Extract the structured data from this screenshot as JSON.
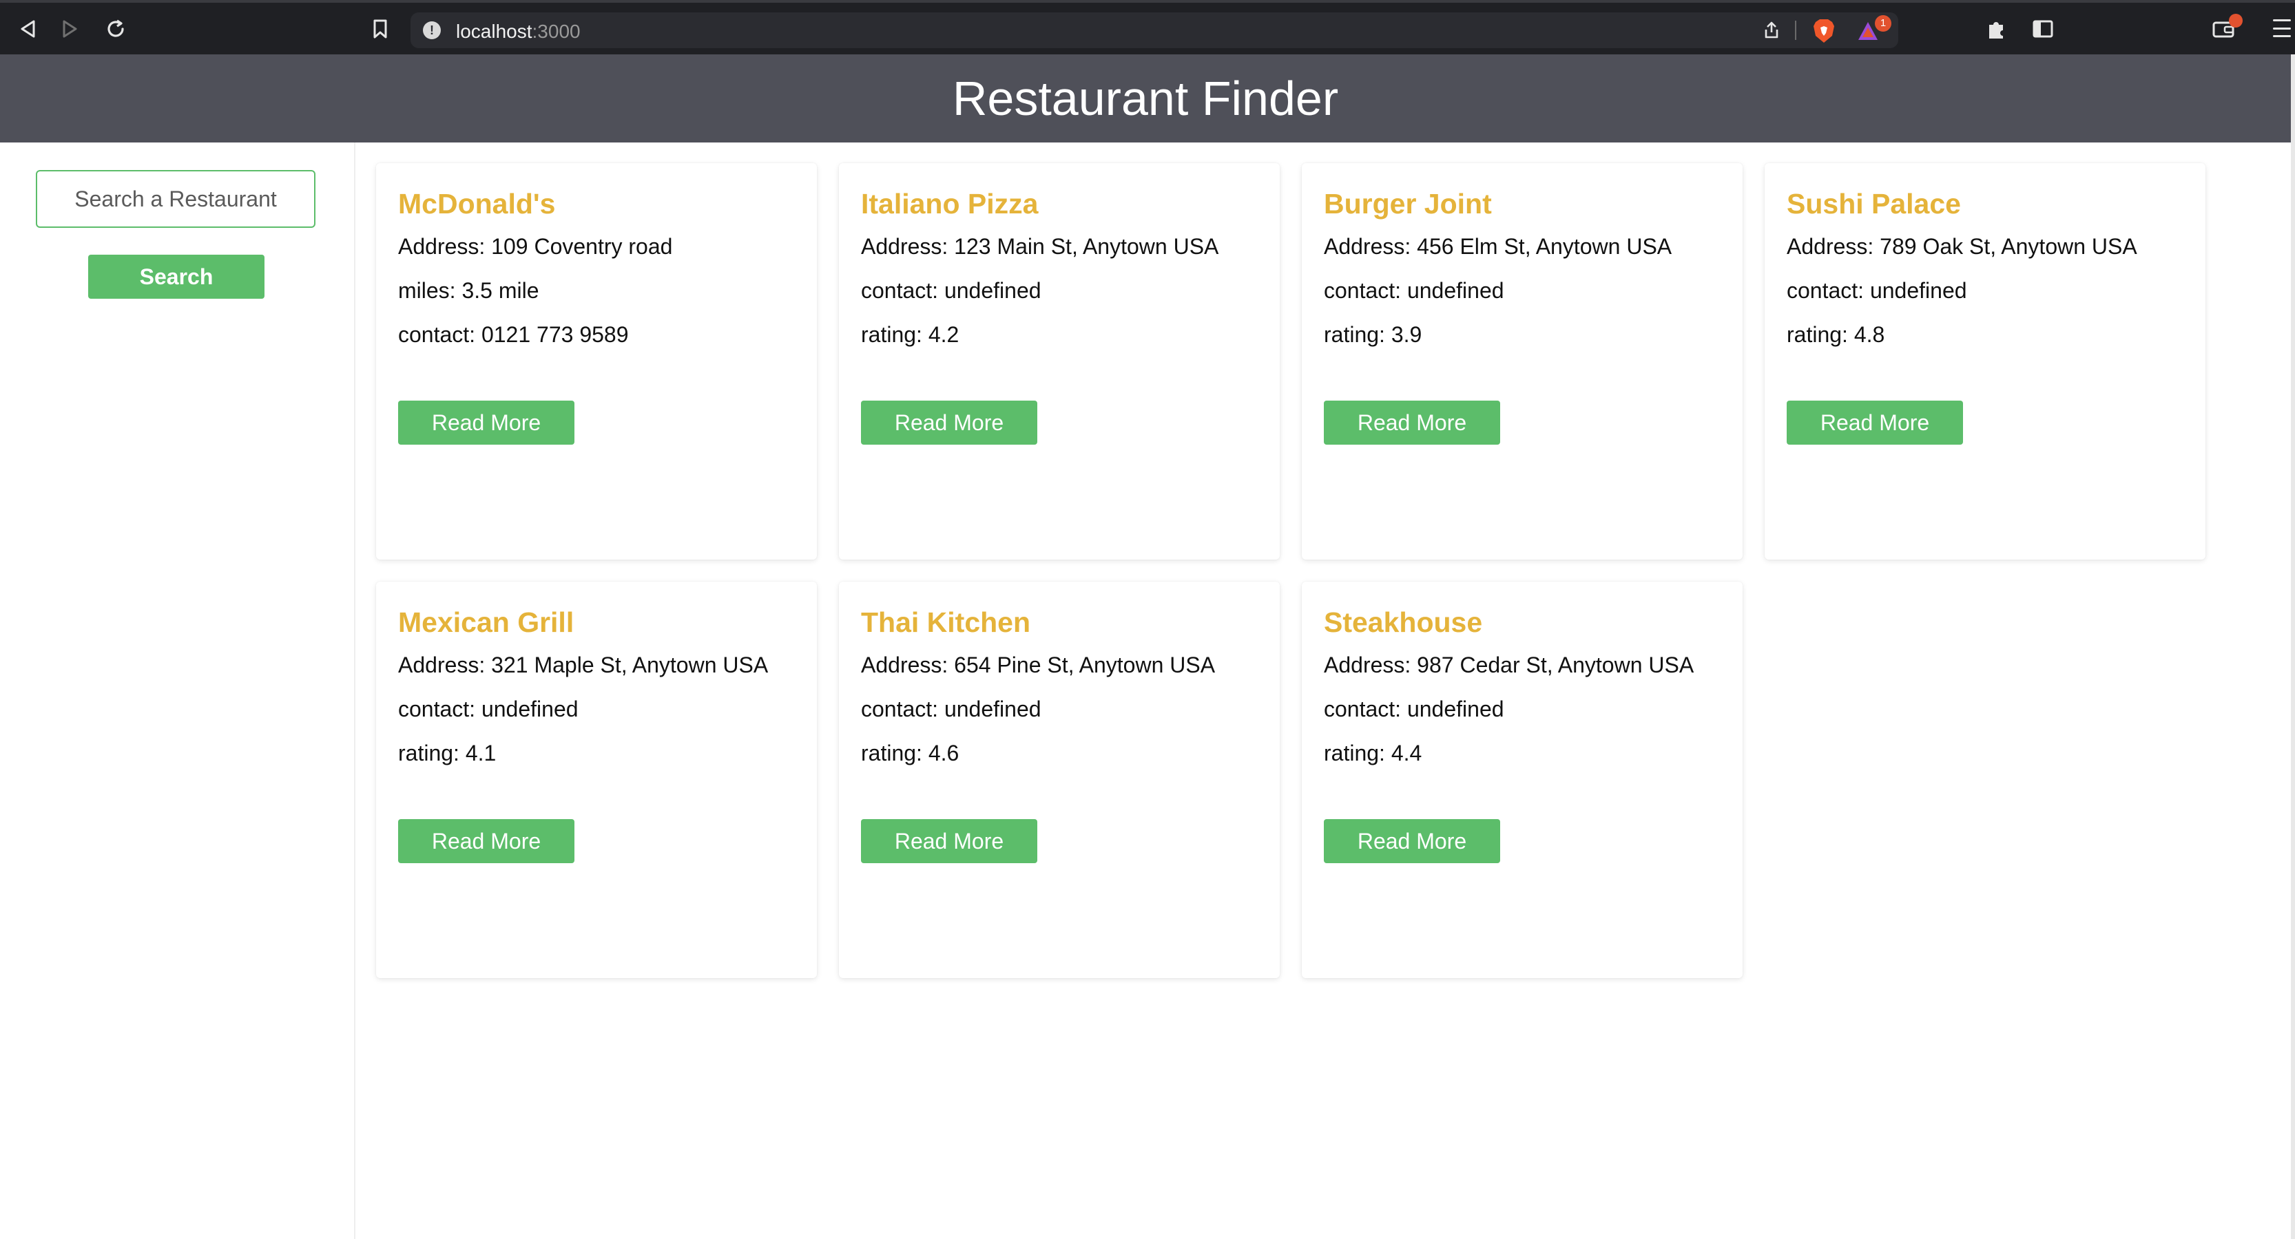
{
  "browser": {
    "url_host": "localhost",
    "url_port": ":3000",
    "rewards_badge": "1"
  },
  "header": {
    "title": "Restaurant Finder"
  },
  "sidebar": {
    "search_placeholder": "Search a Restaurant",
    "search_button": "Search"
  },
  "colors": {
    "accent_green": "#5cbd6a",
    "title_gold": "#e5b33a",
    "header_bg": "#4f5059"
  },
  "restaurants": [
    {
      "name": "McDonald's",
      "lines": [
        "Address: 109 Coventry road",
        "miles: 3.5 mile",
        "contact: 0121 773 9589"
      ],
      "button": "Read More"
    },
    {
      "name": "Italiano Pizza",
      "lines": [
        "Address: 123 Main St, Anytown USA",
        "contact: undefined",
        "rating: 4.2"
      ],
      "button": "Read More"
    },
    {
      "name": "Burger Joint",
      "lines": [
        "Address: 456 Elm St, Anytown USA",
        "contact: undefined",
        "rating: 3.9"
      ],
      "button": "Read More"
    },
    {
      "name": "Sushi Palace",
      "lines": [
        "Address: 789 Oak St, Anytown USA",
        "contact: undefined",
        "rating: 4.8"
      ],
      "button": "Read More"
    },
    {
      "name": "Mexican Grill",
      "lines": [
        "Address: 321 Maple St, Anytown USA",
        "contact: undefined",
        "rating: 4.1"
      ],
      "button": "Read More"
    },
    {
      "name": "Thai Kitchen",
      "lines": [
        "Address: 654 Pine St, Anytown USA",
        "contact: undefined",
        "rating: 4.6"
      ],
      "button": "Read More"
    },
    {
      "name": "Steakhouse",
      "lines": [
        "Address: 987 Cedar St, Anytown USA",
        "contact: undefined",
        "rating: 4.4"
      ],
      "button": "Read More"
    }
  ]
}
